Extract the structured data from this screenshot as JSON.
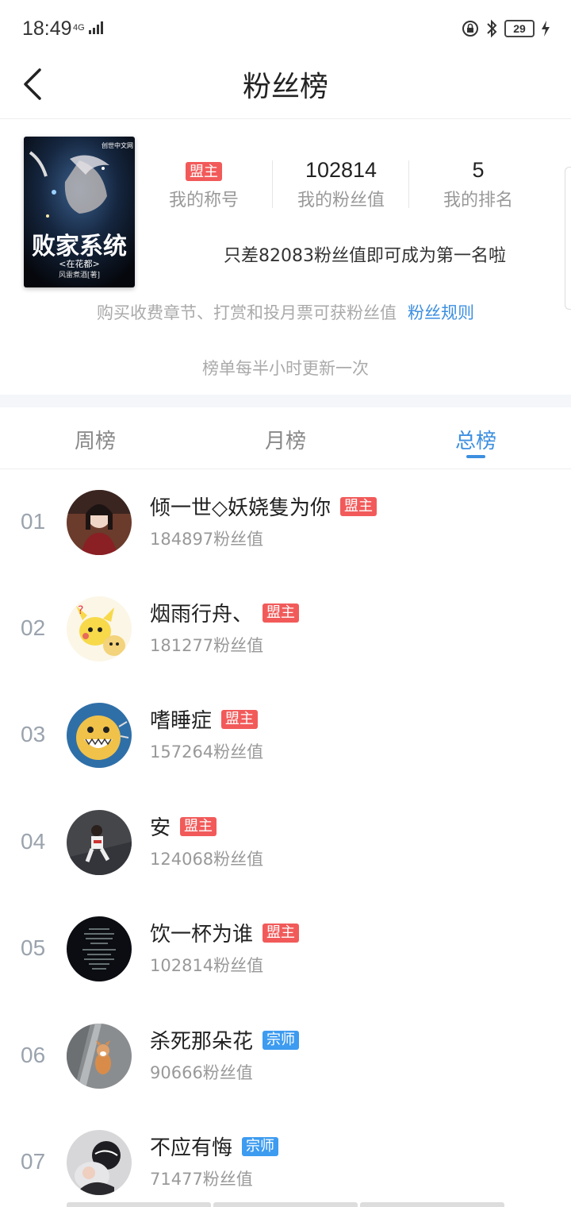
{
  "status_bar": {
    "time": "18:49",
    "network": "4G",
    "battery": "29"
  },
  "navbar": {
    "title": "粉丝榜"
  },
  "book": {
    "cover_title": "败家系统",
    "cover_subtitle": "<在花都>",
    "cover_author": "风雷煮酒[著]",
    "cover_publisher": "创世中文网"
  },
  "stats": {
    "my_title_badge": "盟主",
    "my_title_label": "我的称号",
    "fan_value": "102814",
    "fan_value_label": "我的粉丝值",
    "rank": "5",
    "rank_label": "我的排名"
  },
  "tip": "只差82083粉丝值即可成为第一名啦",
  "rule_text": "购买收费章节、打赏和投月票可获粉丝值",
  "rule_link": "粉丝规则",
  "update_text": "榜单每半小时更新一次",
  "tabs": [
    {
      "label": "周榜",
      "active": false
    },
    {
      "label": "月榜",
      "active": false
    },
    {
      "label": "总榜",
      "active": true
    }
  ],
  "list": [
    {
      "rank": "01",
      "name": "倾一世◇妖娆隻为你",
      "badge": "盟主",
      "badge_color": "#f25a5a",
      "score": "184897粉丝值"
    },
    {
      "rank": "02",
      "name": "烟雨行舟、",
      "badge": "盟主",
      "badge_color": "#f25a5a",
      "score": "181277粉丝值"
    },
    {
      "rank": "03",
      "name": "嗜睡症",
      "badge": "盟主",
      "badge_color": "#f25a5a",
      "score": "157264粉丝值"
    },
    {
      "rank": "04",
      "name": "安",
      "badge": "盟主",
      "badge_color": "#f25a5a",
      "score": "124068粉丝值"
    },
    {
      "rank": "05",
      "name": "饮一杯为谁",
      "badge": "盟主",
      "badge_color": "#f25a5a",
      "score": "102814粉丝值"
    },
    {
      "rank": "06",
      "name": "杀死那朵花",
      "badge": "宗师",
      "badge_color": "#3d9bf0",
      "score": "90666粉丝值"
    },
    {
      "rank": "07",
      "name": "不应有悔",
      "badge": "宗师",
      "badge_color": "#3d9bf0",
      "score": "71477粉丝值"
    }
  ]
}
